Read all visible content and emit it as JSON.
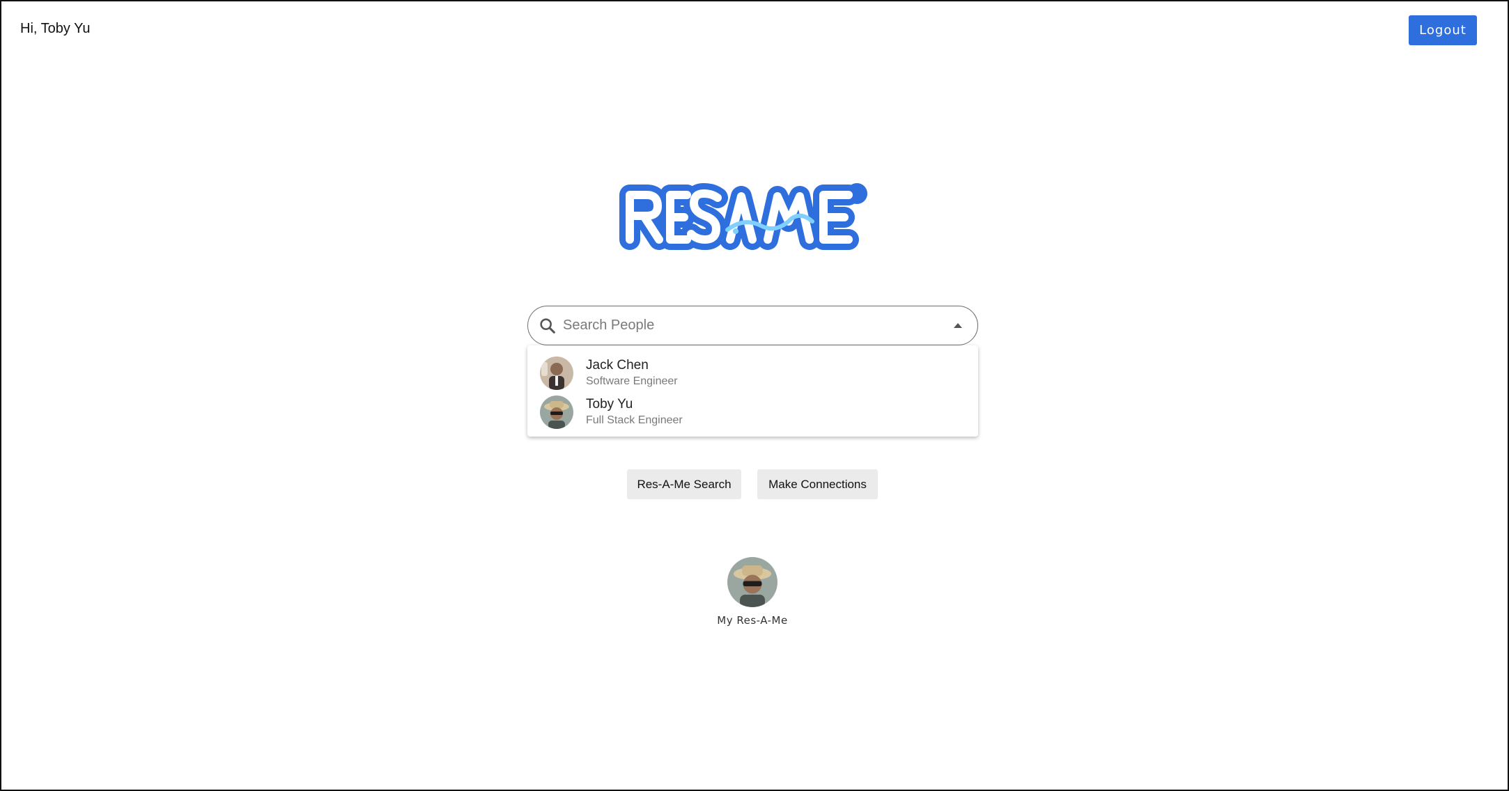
{
  "header": {
    "greeting": "Hi, Toby Yu",
    "logout_label": "Logout"
  },
  "logo": {
    "text": "RES-A-ME",
    "brand_color": "#2e6fdd",
    "accent_color": "#7fd0ff"
  },
  "search": {
    "placeholder": "Search People",
    "value": "",
    "results": [
      {
        "name": "Jack Chen",
        "title": "Software Engineer",
        "icon": "avatar-jack-chen"
      },
      {
        "name": "Toby Yu",
        "title": "Full Stack Engineer",
        "icon": "avatar-toby-yu"
      }
    ]
  },
  "actions": {
    "search_label": "Res-A-Me Search",
    "connect_label": "Make Connections"
  },
  "profile": {
    "label": "My Res-A-Me",
    "icon": "avatar-toby-yu"
  }
}
